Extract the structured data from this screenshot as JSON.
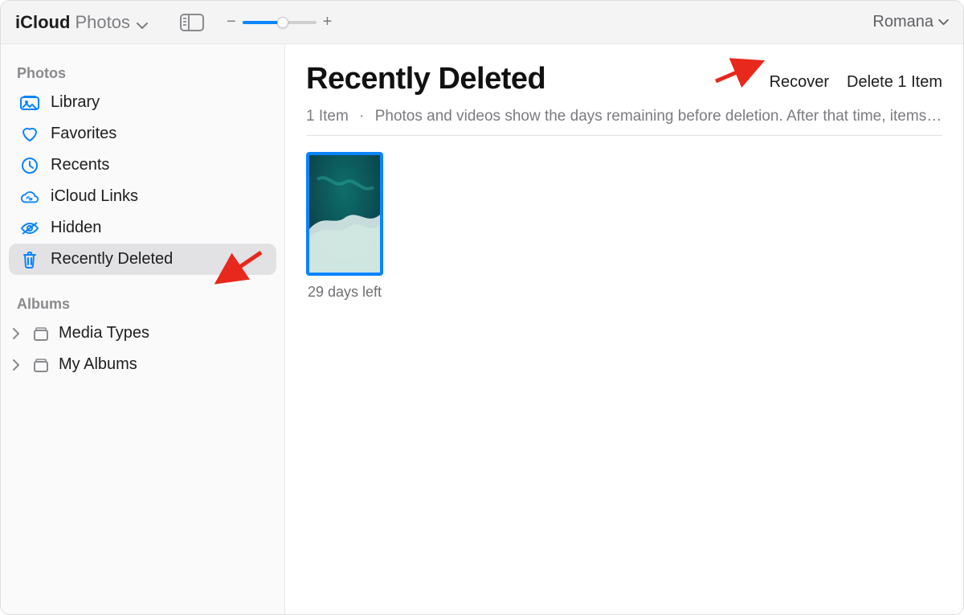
{
  "toolbar": {
    "app_name_strong": "iCloud",
    "app_name_light": "Photos",
    "user_name": "Romana",
    "zoom_percent": 55
  },
  "sidebar": {
    "sections": {
      "photos": {
        "header": "Photos"
      },
      "albums": {
        "header": "Albums"
      }
    },
    "items": [
      {
        "label": "Library"
      },
      {
        "label": "Favorites"
      },
      {
        "label": "Recents"
      },
      {
        "label": "iCloud Links"
      },
      {
        "label": "Hidden"
      },
      {
        "label": "Recently Deleted"
      }
    ],
    "album_items": [
      {
        "label": "Media Types"
      },
      {
        "label": "My Albums"
      }
    ]
  },
  "content": {
    "title": "Recently Deleted",
    "actions": {
      "recover": "Recover",
      "delete": "Delete 1 Item"
    },
    "count_label": "1 Item",
    "note": "Photos and videos show the days remaining before deletion. After that time, items …",
    "thumbnails": [
      {
        "caption": "29 days left"
      }
    ]
  },
  "colors": {
    "accent": "#0a84ff",
    "annotation": "#e8281c"
  }
}
